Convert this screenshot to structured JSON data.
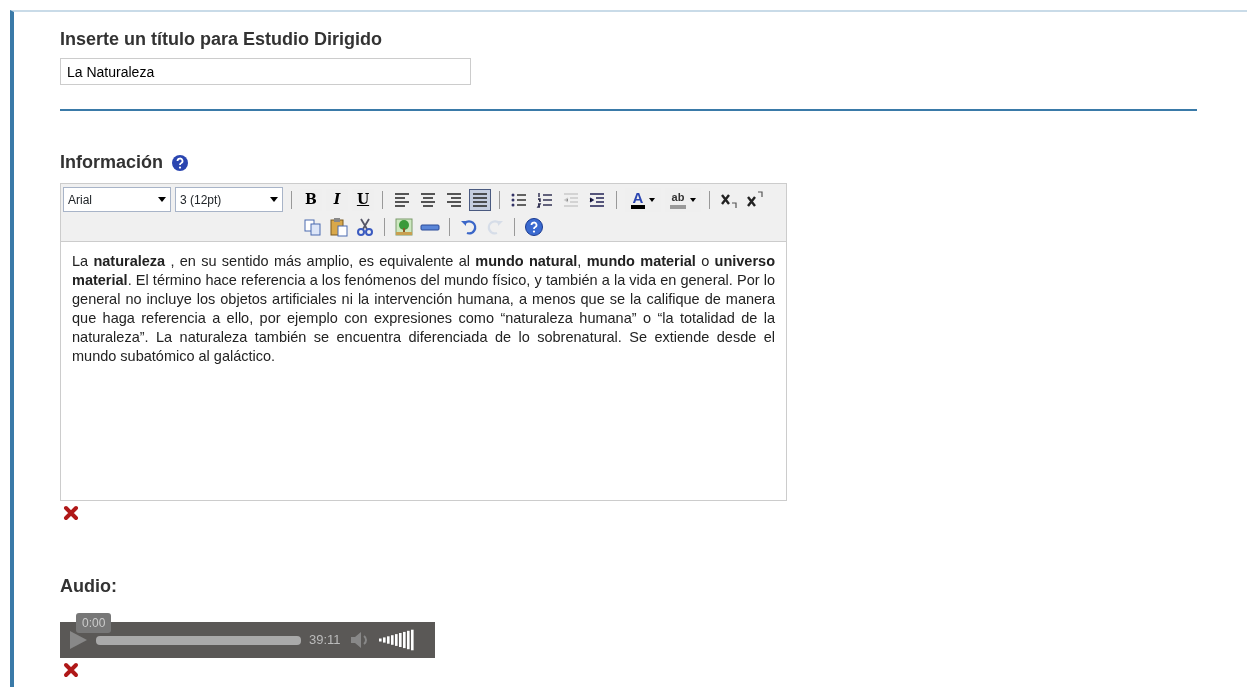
{
  "title_section": {
    "label": "Inserte un título para Estudio Dirigido",
    "value": "La Naturaleza"
  },
  "info_section": {
    "label": "Información",
    "toolbar": {
      "rows": [
        [
          {
            "kind": "select",
            "value": "Arial"
          },
          {
            "kind": "select",
            "value": "3 (12pt)"
          },
          {
            "kind": "sep"
          },
          {
            "kind": "bold",
            "label": "B"
          },
          {
            "kind": "italic",
            "label": "I"
          },
          {
            "kind": "underline",
            "label": "U"
          },
          {
            "kind": "sep"
          },
          {
            "kind": "align-left",
            "selected": false
          },
          {
            "kind": "align-center",
            "selected": false
          },
          {
            "kind": "align-right",
            "selected": false
          },
          {
            "kind": "justify",
            "selected": true
          },
          {
            "kind": "sep"
          },
          {
            "kind": "bullets"
          },
          {
            "kind": "numbers"
          },
          {
            "kind": "outdent",
            "disabled": true
          },
          {
            "kind": "indent"
          },
          {
            "kind": "sep"
          },
          {
            "kind": "font-color",
            "label": "A"
          },
          {
            "kind": "highlight",
            "label": "ab"
          },
          {
            "kind": "sep"
          },
          {
            "kind": "subscript"
          },
          {
            "kind": "superscript"
          }
        ],
        [
          {
            "kind": "copy"
          },
          {
            "kind": "paste"
          },
          {
            "kind": "cut"
          },
          {
            "kind": "sep"
          },
          {
            "kind": "image"
          },
          {
            "kind": "rule"
          },
          {
            "kind": "sep"
          },
          {
            "kind": "undo"
          },
          {
            "kind": "redo",
            "disabled": true
          },
          {
            "kind": "sep"
          },
          {
            "kind": "help"
          }
        ]
      ]
    },
    "text": "La **naturaleza** , en su sentido más amplio, es equivalente al **mundo natural**, **mundo material** o **universo material**. El término hace referencia a los fenómenos del mundo físico, y también a la vida en general. Por lo general no incluye los objetos artificiales ni la intervención humana, a menos que se la califique de manera que haga referencia a ello, por ejemplo con expresiones como “naturaleza humana” o “la totalidad de la naturaleza”. La naturaleza también se encuentra diferenciada de lo sobrenatural. Se extiende desde el mundo subatómico al galáctico."
  },
  "audio_section": {
    "label": "Audio:",
    "player": {
      "current_time": "0:00",
      "duration": "39:11"
    }
  }
}
